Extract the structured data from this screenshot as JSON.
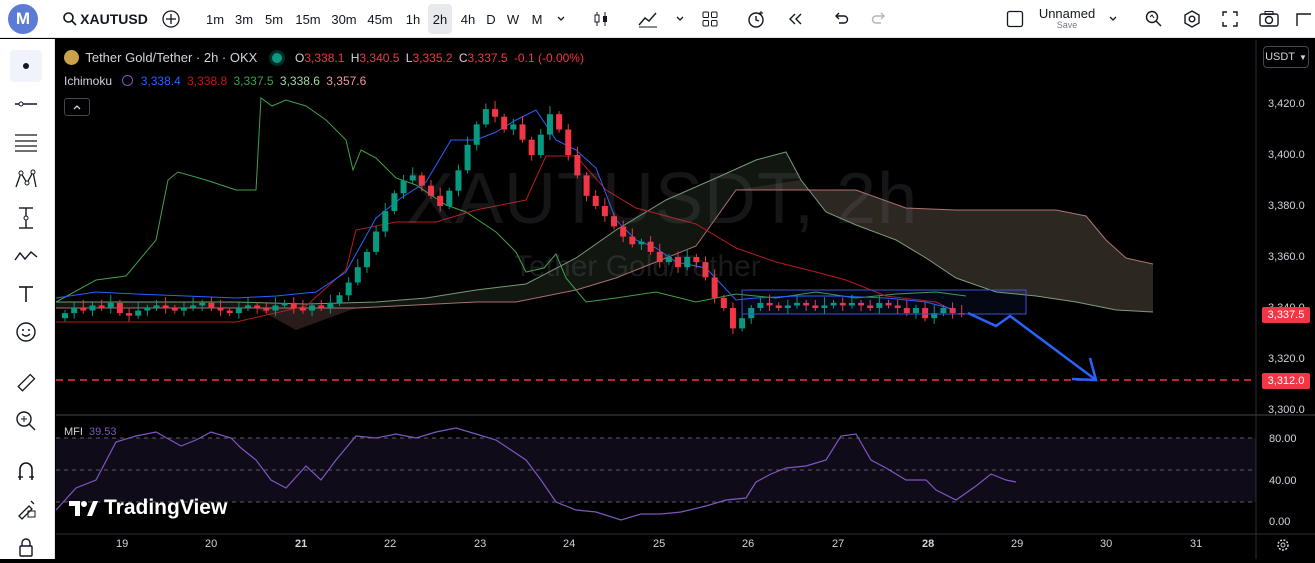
{
  "toolbar": {
    "logo": "M",
    "symbol": "XAUTUSD",
    "add_symbol": "+",
    "intervals": [
      "1m",
      "3m",
      "5m",
      "15m",
      "30m",
      "45m",
      "1h",
      "2h",
      "4h",
      "D",
      "W",
      "M"
    ],
    "active_interval": "2h",
    "layout_name": "Unnamed",
    "save_label": "Save"
  },
  "legend": {
    "title": "Tether Gold/Tether · 2h · OKX",
    "ohlc": {
      "o_label": "O",
      "o": "3,338.1",
      "h_label": "H",
      "h": "3,340.5",
      "l_label": "L",
      "l": "3,335.2",
      "c_label": "C",
      "c": "3,337.5",
      "change": "-0.1 (-0.00%)"
    },
    "indicator_name": "Ichimoku",
    "indicator_values": [
      "3,338.4",
      "3,338.8",
      "3,337.5",
      "3,338.6",
      "3,357.6"
    ],
    "mfi_name": "MFI",
    "mfi_value": "39.53"
  },
  "watermark": {
    "symbol": "XAUTUSDT, 2h",
    "name": "Tether Gold/Tether"
  },
  "currency_button": "USDT",
  "price_axis": [
    "3,420.0",
    "3,400.0",
    "3,380.0",
    "3,360.0",
    "3,340.0",
    "3,320.0",
    "3,300.0"
  ],
  "price_tags": {
    "last": "3,337.5",
    "target": "3,312.0"
  },
  "mfi_axis": [
    "80.00",
    "40.00",
    "0.00"
  ],
  "time_axis": [
    "19",
    "20",
    "21",
    "22",
    "23",
    "24",
    "25",
    "26",
    "27",
    "28",
    "29",
    "30",
    "31"
  ],
  "bold_days": [
    "21",
    "28"
  ],
  "brand": "TradingView",
  "colors": {
    "up": "#089981",
    "down": "#f23645",
    "tenkan": "#2962ff",
    "kijun": "#b71c1c",
    "lagging": "#43a047",
    "span_a": "#a5d6a7",
    "span_b": "#ef9a9a",
    "mfi": "#7e57c2",
    "target": "#f23645",
    "arrow": "#2962ff"
  }
}
